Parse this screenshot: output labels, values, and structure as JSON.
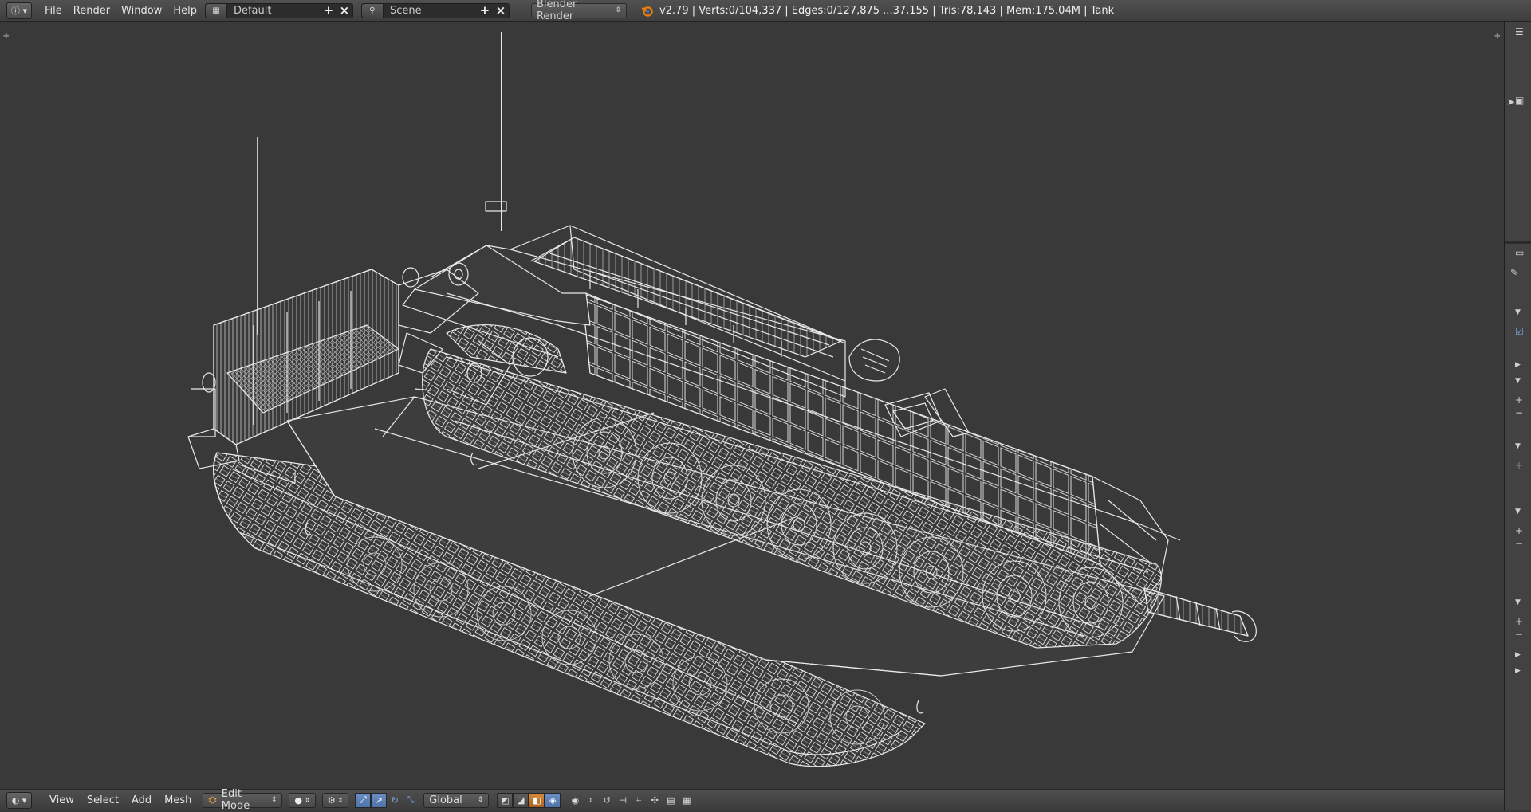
{
  "topbar": {
    "editor_icon": "info-icon",
    "menus": [
      "File",
      "Render",
      "Window",
      "Help"
    ],
    "layout": {
      "icon": "screen-layout-icon",
      "name": "Default"
    },
    "scene": {
      "icon": "scene-icon",
      "name": "Scene"
    },
    "render_engine": "Blender Render",
    "stats": "v2.79 | Verts:0/104,337 | Edges:0/127,875 ...37,155 | Tris:78,143 | Mem:175.04M | Tank"
  },
  "viewport": {
    "object_name": "Tank",
    "display": "wireframe",
    "background": "#393939",
    "wire_color": "#e8e8e8"
  },
  "bottombar": {
    "editor_icon": "3d-view-icon",
    "menus": [
      "View",
      "Select",
      "Add",
      "Mesh"
    ],
    "mode": "Edit Mode",
    "viewport_shading": "solid-sphere-icon",
    "pivot": "pivot-icon",
    "transform_orientation": "Global",
    "manipulator_tools": [
      "translate-icon",
      "rotate-icon",
      "scale-icon"
    ],
    "select_modes": [
      "vertex-select-icon",
      "edge-select-icon",
      "face-select-icon"
    ],
    "accent": "#5a7fb5"
  },
  "rightpanel": {
    "icons": [
      "outliner-icon",
      "cursor-icon",
      "camera-icon",
      "properties-icon",
      "wrench-icon",
      "checkbox-icon",
      "plus-icon",
      "minus-icon"
    ]
  }
}
